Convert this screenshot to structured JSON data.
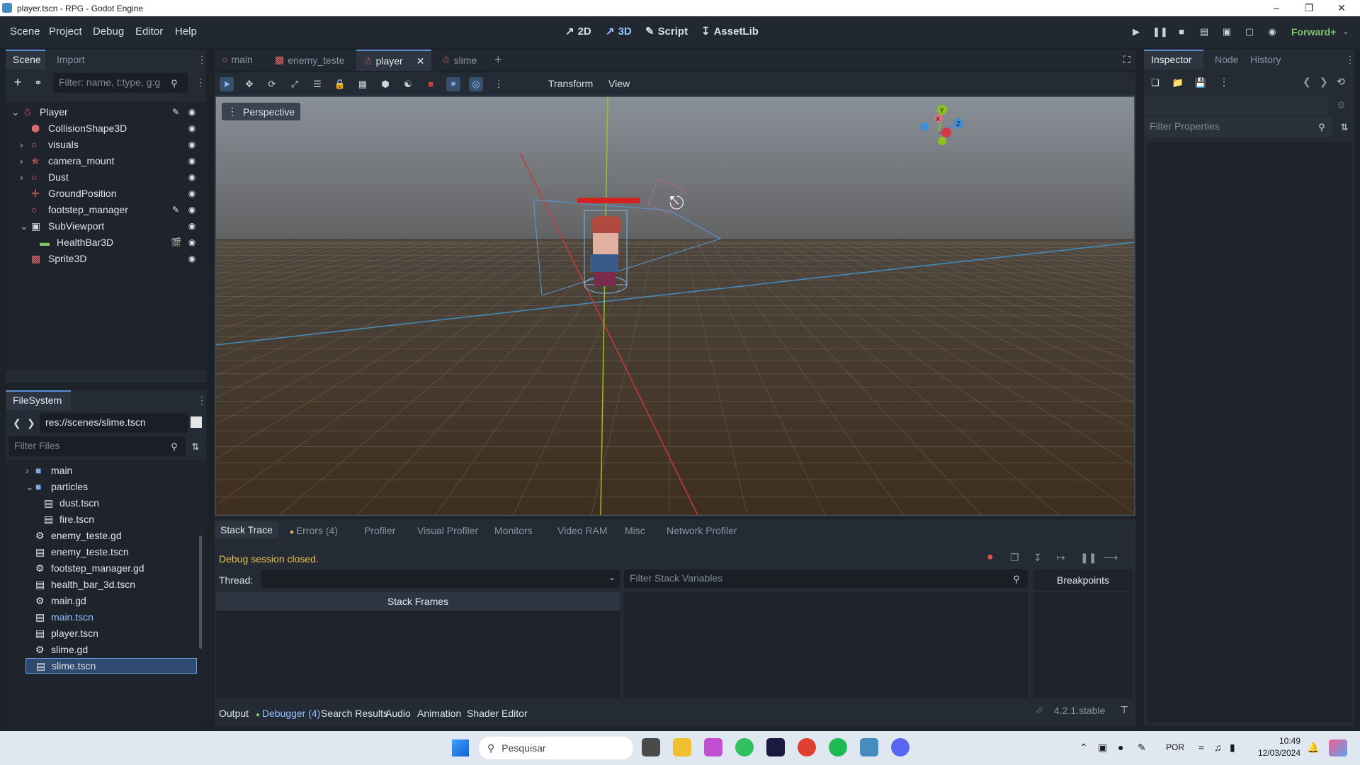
{
  "window": {
    "title": "player.tscn - RPG - Godot Engine"
  },
  "menu": {
    "items": [
      "Scene",
      "Project",
      "Debug",
      "Editor",
      "Help"
    ]
  },
  "workspaces": {
    "w2d": "2D",
    "w3d": "3D",
    "script": "Script",
    "assetlib": "AssetLib"
  },
  "renderer": "Forward+",
  "scene_dock": {
    "tabs": {
      "scene": "Scene",
      "import": "Import"
    },
    "filter_placeholder": "Filter: name, t:type, g:g",
    "nodes": [
      {
        "name": "Player",
        "icon": "character-body-icon"
      },
      {
        "name": "CollisionShape3D",
        "icon": "collision-shape-icon"
      },
      {
        "name": "visuals",
        "icon": "node3d-icon"
      },
      {
        "name": "camera_mount",
        "icon": "camera-mount-icon"
      },
      {
        "name": "Dust",
        "icon": "node3d-icon"
      },
      {
        "name": "GroundPosition",
        "icon": "marker3d-icon"
      },
      {
        "name": "footstep_manager",
        "icon": "node3d-icon"
      },
      {
        "name": "SubViewport",
        "icon": "subviewport-icon"
      },
      {
        "name": "HealthBar3D",
        "icon": "progressbar-icon"
      },
      {
        "name": "Sprite3D",
        "icon": "sprite3d-icon"
      }
    ]
  },
  "filesystem": {
    "title": "FileSystem",
    "path": "res://scenes/slime.tscn",
    "filter_placeholder": "Filter Files",
    "items": [
      {
        "name": "main",
        "icon": "folder-icon"
      },
      {
        "name": "particles",
        "icon": "folder-icon"
      },
      {
        "name": "dust.tscn",
        "icon": "scene-file-icon"
      },
      {
        "name": "fire.tscn",
        "icon": "scene-file-icon"
      },
      {
        "name": "enemy_teste.gd",
        "icon": "gear-icon"
      },
      {
        "name": "enemy_teste.tscn",
        "icon": "scene-file-icon"
      },
      {
        "name": "footstep_manager.gd",
        "icon": "gear-icon"
      },
      {
        "name": "health_bar_3d.tscn",
        "icon": "scene-file-icon"
      },
      {
        "name": "main.gd",
        "icon": "gear-icon"
      },
      {
        "name": "main.tscn",
        "icon": "scene-file-icon"
      },
      {
        "name": "player.tscn",
        "icon": "scene-file-icon"
      },
      {
        "name": "slime.gd",
        "icon": "gear-icon"
      },
      {
        "name": "slime.tscn",
        "icon": "scene-file-icon"
      }
    ]
  },
  "scene_tabs": [
    "main",
    "enemy_teste",
    "player",
    "slime"
  ],
  "viewport": {
    "perspective_label": "Perspective",
    "menus": {
      "transform": "Transform",
      "view": "View"
    },
    "gizmo": {
      "x": "X",
      "y": "Y",
      "z": "Z"
    }
  },
  "debugger": {
    "tabs": [
      "Stack Trace",
      "Errors (4)",
      "Profiler",
      "Visual Profiler",
      "Monitors",
      "Video RAM",
      "Misc",
      "Network Profiler"
    ],
    "status": "Debug session closed.",
    "thread_label": "Thread:",
    "filter_placeholder": "Filter Stack Variables",
    "breakpoints": "Breakpoints",
    "stack_frames": "Stack Frames"
  },
  "bottom_tabs": [
    "Output",
    "Debugger (4)",
    "Search Results",
    "Audio",
    "Animation",
    "Shader Editor"
  ],
  "version": "4.2.1.stable",
  "inspector": {
    "tabs": {
      "inspector": "Inspector",
      "node": "Node",
      "history": "History"
    },
    "filter_placeholder": "Filter Properties"
  },
  "taskbar": {
    "search_placeholder": "Pesquisar",
    "lang": "POR",
    "time": "10:49",
    "date": "12/03/2024"
  },
  "colors": {
    "accent": "#5a8fd8",
    "health_bar": "#d42020",
    "status_text": "#e8c04a"
  }
}
